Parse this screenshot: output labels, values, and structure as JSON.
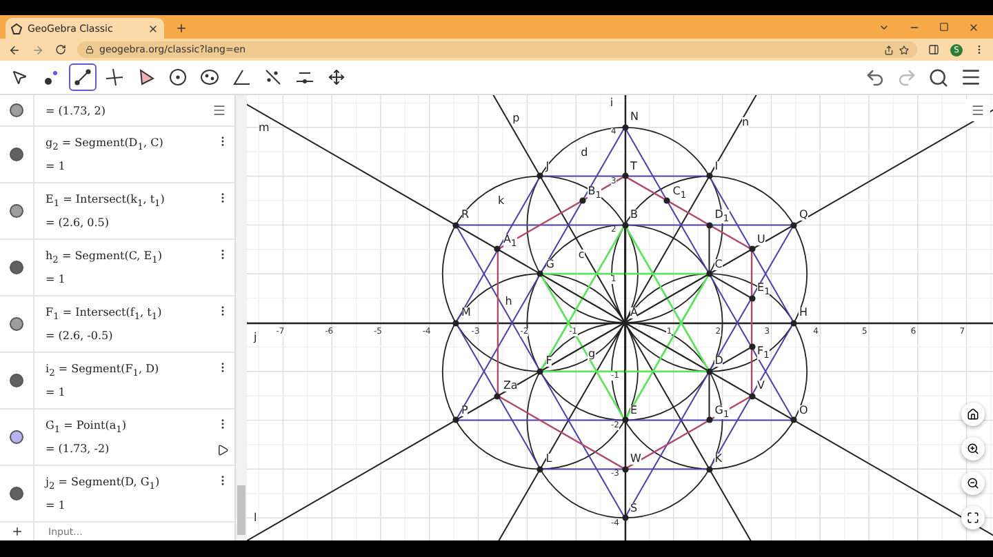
{
  "browser": {
    "tab_title": "GeoGebra Classic",
    "url": "geogebra.org/classic?lang=en",
    "avatar": "S"
  },
  "toolbar": {
    "tools": [
      {
        "kind": "move",
        "selected": false
      },
      {
        "kind": "point",
        "selected": false
      },
      {
        "kind": "segment",
        "selected": true
      },
      {
        "kind": "perpendicular",
        "selected": false
      },
      {
        "kind": "polygon",
        "selected": false
      },
      {
        "kind": "circle",
        "selected": false
      },
      {
        "kind": "ellipse",
        "selected": false
      },
      {
        "kind": "angle",
        "selected": false
      },
      {
        "kind": "reflect",
        "selected": false
      },
      {
        "kind": "slider",
        "selected": false
      },
      {
        "kind": "pan",
        "selected": false
      }
    ]
  },
  "algebra": {
    "items": [
      {
        "value": "= (1.73, 2)",
        "color": "#9e9e9e",
        "animated": false
      },
      {
        "definition": "g$_{2}$ = Segment(D$_{1}$, C)",
        "value": "= 1",
        "color": "#616161",
        "animated": false
      },
      {
        "definition": "E$_{1}$ = Intersect(k$_{1}$, t$_{1}$)",
        "value": "= (2.6, 0.5)",
        "color": "#9e9e9e",
        "animated": false
      },
      {
        "definition": "h$_{2}$ = Segment(C, E$_{1}$)",
        "value": "= 1",
        "color": "#616161",
        "animated": false
      },
      {
        "definition": "F$_{1}$ = Intersect(f$_{1}$, t$_{1}$)",
        "value": "= (2.6, -0.5)",
        "color": "#9e9e9e",
        "animated": false
      },
      {
        "definition": "i$_{2}$ = Segment(F$_{1}$, D)",
        "value": "= 1",
        "color": "#616161",
        "animated": false
      },
      {
        "definition": "G$_{1}$ = Point(a$_{1}$)",
        "value": "= (1.73, -2)",
        "color": "#b4b4f4",
        "animated": true
      },
      {
        "definition": "j$_{2}$ = Segment(D, G$_{1}$)",
        "value": "= 1",
        "color": "#616161",
        "animated": false
      }
    ],
    "input_placeholder": "Input..."
  },
  "graphics": {
    "x_ticks": [
      "-7",
      "-6",
      "-5",
      "-4",
      "-3",
      "-2",
      "-1",
      "1",
      "2",
      "3",
      "4",
      "5",
      "6",
      "7"
    ],
    "y_ticks": [
      "4",
      "3",
      "2",
      "1",
      "-1",
      "-2",
      "-3",
      "-4"
    ],
    "line_labels": [
      "m",
      "p",
      "i",
      "n",
      "d",
      "k",
      "c",
      "h",
      "j",
      "g",
      "l"
    ],
    "points": [
      "N",
      "J",
      "T",
      "I",
      "B$_{1}$",
      "C$_{1}$",
      "R",
      "B",
      "D$_{1}$",
      "Q",
      "A$_{1}$",
      "U",
      "G",
      "C",
      "E$_{1}$",
      "M",
      "A",
      "H",
      "F$_{1}$",
      "F",
      "D",
      "Za",
      "V",
      "P",
      "E",
      "G$_{1}$",
      "O",
      "L",
      "W",
      "K",
      "S"
    ]
  }
}
